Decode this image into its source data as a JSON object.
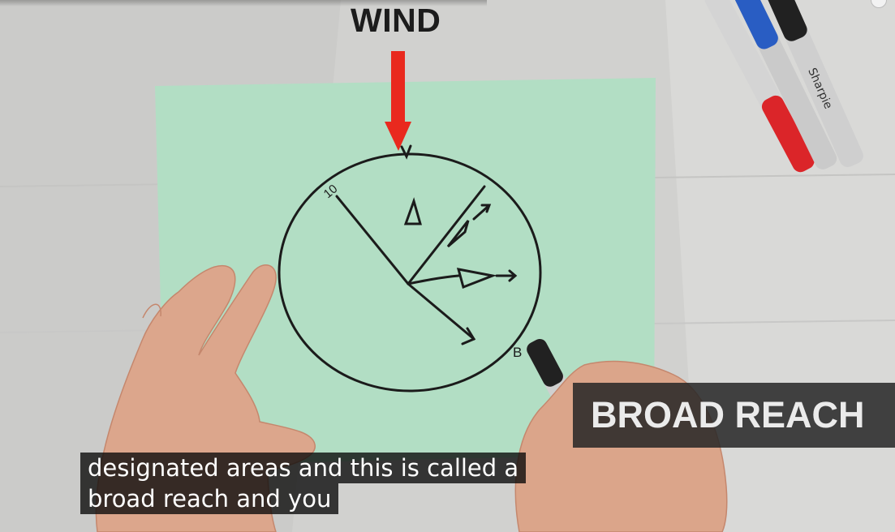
{
  "video": {
    "overlay_title": "WIND",
    "lower_third": "BROAD REACH",
    "captions": [
      "designated areas and this is called a",
      "broad reach and you"
    ],
    "diagram_marks": {
      "top_left_mark": "10",
      "bottom_right_mark": "B"
    }
  },
  "colors": {
    "paper": "#b6e3c8",
    "arrow": "#ee2a1f",
    "ink": "#1c1c1c",
    "caption_bg": "#080808",
    "lower_third_bg": "#262626"
  }
}
